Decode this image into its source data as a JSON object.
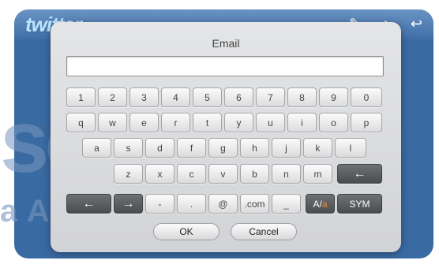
{
  "background": {
    "app_logo": "twitter",
    "watermark_large": "son",
    "watermark_small": "a Authority™"
  },
  "dialog": {
    "title": "Email",
    "input_value": "",
    "ok_label": "OK",
    "cancel_label": "Cancel"
  },
  "keyboard": {
    "row1": [
      "1",
      "2",
      "3",
      "4",
      "5",
      "6",
      "7",
      "8",
      "9",
      "0"
    ],
    "row2": [
      "q",
      "w",
      "e",
      "r",
      "t",
      "y",
      "u",
      "i",
      "o",
      "p"
    ],
    "row3": [
      "a",
      "s",
      "d",
      "f",
      "g",
      "h",
      "j",
      "k",
      "l"
    ],
    "row4": [
      "z",
      "x",
      "c",
      "v",
      "b",
      "n",
      "m"
    ],
    "row5": {
      "left_arrow": "←",
      "right_arrow": "→",
      "dash": "-",
      "dot": ".",
      "at": "@",
      "dotcom": ".com",
      "underscore": "_",
      "case_a_upper": "A/",
      "case_a_lower": "a",
      "sym": "SYM",
      "backspace": "←"
    }
  },
  "colors": {
    "accent": "#f08a2a",
    "dark_key": "#4a4c4f",
    "app_blue": "#3a6aa2"
  }
}
